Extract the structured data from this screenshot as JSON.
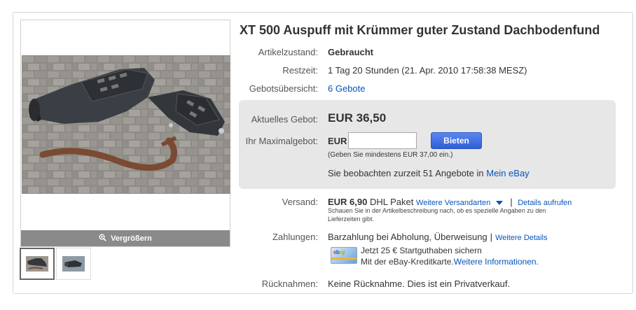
{
  "gallery": {
    "zoom_label": "Vergrößern"
  },
  "item": {
    "title": "XT 500 Auspuff mit Krümmer guter Zustand Dachbodenfund"
  },
  "details": {
    "condition_label": "Artikelzustand:",
    "condition_value": "Gebraucht",
    "time_left_label": "Restzeit:",
    "time_left_value": "1 Tag 20 Stunden (21. Apr. 2010 17:58:38 MESZ)",
    "bid_history_label": "Gebotsübersicht:",
    "bid_history_value": "6 Gebote"
  },
  "bidding": {
    "current_bid_label": "Aktuelles Gebot:",
    "current_bid_value": "EUR 36,50",
    "max_bid_label": "Ihr Maximalgebot:",
    "currency": "EUR",
    "max_bid_value": "",
    "bid_button": "Bieten",
    "min_hint": "(Geben Sie mindestens EUR 37,00 ein.)",
    "watching_text": "Sie beobachten zurzeit 51 Angebote in",
    "watching_link": "Mein eBay"
  },
  "shipping": {
    "label": "Versand:",
    "price": "EUR 6,90",
    "method": "DHL Paket",
    "more_link": "Weitere Versandarten",
    "details_link": "Details aufrufen",
    "note_line1": "Schauen Sie in der Artikelbeschreibung nach, ob es spezielle Angaben zu den",
    "note_line2": "Lieferzeiten gibt."
  },
  "payment": {
    "label": "Zahlungen:",
    "methods": "Barzahlung bei Abholung, Überweisung",
    "more_link": "Weitere Details",
    "promo_line1": "Jetzt 25 € Startguthaben sichern",
    "promo_line2_prefix": "Mit der eBay-Kreditkarte.",
    "promo_link": "Weitere Informationen",
    "promo_line2_suffix": "."
  },
  "returns": {
    "label": "Rücknahmen:",
    "value": "Keine Rücknahme. Dies ist ein Privatverkauf."
  },
  "colors": {
    "link": "#0654ba",
    "bid_button": "#3a66dd",
    "bid_panel": "#e7e7e7",
    "zoom_bar": "#8a8a8a"
  },
  "icons": {
    "zoom": "magnifier-icon",
    "dropdown": "chevron-down-icon",
    "card": "credit-card-icon"
  }
}
